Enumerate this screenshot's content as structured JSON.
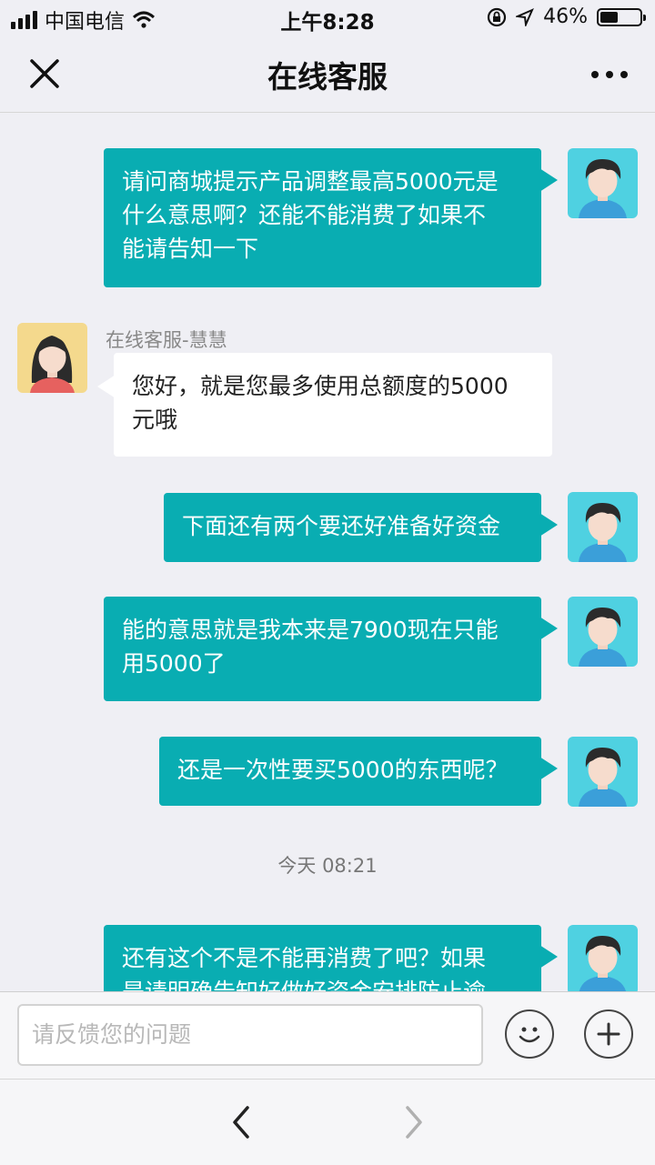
{
  "status": {
    "carrier": "中国电信",
    "time": "上午8:28",
    "battery": "46%",
    "battery_level": 0.46
  },
  "header": {
    "title": "在线客服",
    "close_icon": "close-icon",
    "more_icon": "more-icon"
  },
  "conversation": {
    "messages": [
      {
        "from": "user",
        "lines": [
          "请问商城提示产品调整最高5000元是",
          "什么意思啊？还能不能消费了如果不",
          "能请告知一下"
        ]
      },
      {
        "from": "agent",
        "sender": "在线客服-慧慧",
        "lines": [
          "您好，就是您最多使用总额度的5000",
          "元哦"
        ]
      },
      {
        "from": "user",
        "lines": [
          "下面还有两个要还好准备好资金"
        ]
      },
      {
        "from": "user",
        "lines": [
          "能的意思就是我本来是7900现在只能",
          "用5000了"
        ]
      },
      {
        "from": "user",
        "lines": [
          "还是一次性要买5000的东西呢？"
        ]
      },
      {
        "from": "user",
        "lines": [
          "还有这个不是不能再消费了吧？如果",
          "是请明确告知好做好资金安排防止逾"
        ]
      }
    ],
    "timestamp": "今天 08:21"
  },
  "input": {
    "placeholder": "请反馈您的问题",
    "emoji_icon": "smiley-icon",
    "plus_icon": "plus-icon"
  },
  "bottom_nav": {
    "back_icon": "chevron-left-icon",
    "forward_icon": "chevron-right-icon"
  },
  "colors": {
    "user_bubble": "#09adb2",
    "agent_bubble": "#ffffff",
    "background": "#efeff4",
    "user_avatar_bg": "#4fd1e1",
    "agent_avatar_bg": "#f4d98d"
  }
}
